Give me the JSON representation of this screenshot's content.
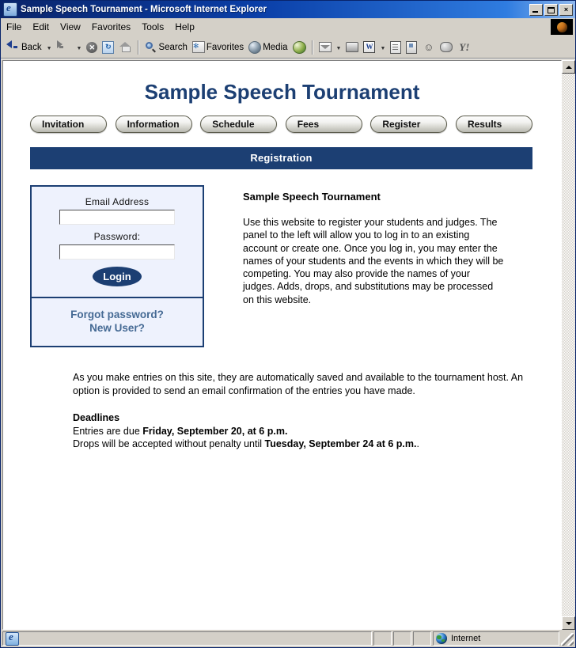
{
  "window": {
    "title": "Sample Speech Tournament - Microsoft Internet Explorer",
    "icon": "ie-document-icon",
    "minimize_label": "Minimize",
    "maximize_label": "Maximize",
    "close_label": "×"
  },
  "menubar": {
    "items": [
      {
        "label": "File"
      },
      {
        "label": "Edit"
      },
      {
        "label": "View"
      },
      {
        "label": "Favorites"
      },
      {
        "label": "Tools"
      },
      {
        "label": "Help"
      }
    ],
    "logo": "windows-flag-logo"
  },
  "toolbar": {
    "back_label": "Back",
    "forward_label": "",
    "buttons": [
      {
        "name": "stop",
        "label": "",
        "glyph": "x"
      },
      {
        "name": "refresh",
        "label": "",
        "glyph": "↻"
      },
      {
        "name": "home",
        "label": "",
        "glyph": ""
      },
      {
        "name": "search",
        "label": "Search",
        "glyph": ""
      },
      {
        "name": "favorites",
        "label": "Favorites",
        "glyph": "✻"
      },
      {
        "name": "media",
        "label": "Media",
        "glyph": ""
      },
      {
        "name": "history",
        "label": "",
        "glyph": ""
      },
      {
        "name": "mail",
        "label": "",
        "glyph": ""
      },
      {
        "name": "print",
        "label": "",
        "glyph": ""
      },
      {
        "name": "edit-word",
        "label": "",
        "glyph": "W"
      },
      {
        "name": "discuss",
        "label": "",
        "glyph": ""
      },
      {
        "name": "research",
        "label": "",
        "glyph": ""
      },
      {
        "name": "messenger",
        "label": "",
        "glyph": ""
      },
      {
        "name": "yahoo",
        "label": "",
        "glyph": "Y"
      }
    ]
  },
  "page": {
    "site_title": "Sample Speech Tournament",
    "nav": [
      {
        "label": "Invitation"
      },
      {
        "label": "Information"
      },
      {
        "label": "Schedule"
      },
      {
        "label": "Fees"
      },
      {
        "label": "Register"
      },
      {
        "label": "Results"
      }
    ],
    "section_banner": "Registration",
    "login": {
      "email_label": "Email Address",
      "email_value": "",
      "email_placeholder": "",
      "password_label": "Password:",
      "password_value": "",
      "password_placeholder": "",
      "login_button": "Login",
      "forgot_link": "Forgot password?",
      "new_user_link": "New User?"
    },
    "intro": {
      "heading": "Sample Speech Tournament",
      "body": "Use this website to register your students and judges. The panel to the left will allow you to log in to an existing account or create one. Once you log in, you may enter the names of your students and the events in which they will be competing. You may also provide the names of your judges. Adds, drops, and substitutions may be processed on this website."
    },
    "notice": "As you make entries on this site, they are automatically saved and available to the tournament host. An option is provided to send an email confirmation of the entries you have made.",
    "deadlines": {
      "heading": "Deadlines",
      "entries_prefix": "Entries are due ",
      "entries_date": "Friday, September 20, at 6 p.m.",
      "drops_prefix": "Drops will be accepted without penalty until ",
      "drops_date": "Tuesday, September 24 at 6 p.m.",
      "drops_suffix": "."
    },
    "colors": {
      "brand_navy": "#1c3f73",
      "panel_background": "#eef2fd",
      "link_blue": "#456a94"
    }
  },
  "statusbar": {
    "message": "",
    "zone": "Internet",
    "zone_icon": "globe-icon"
  }
}
